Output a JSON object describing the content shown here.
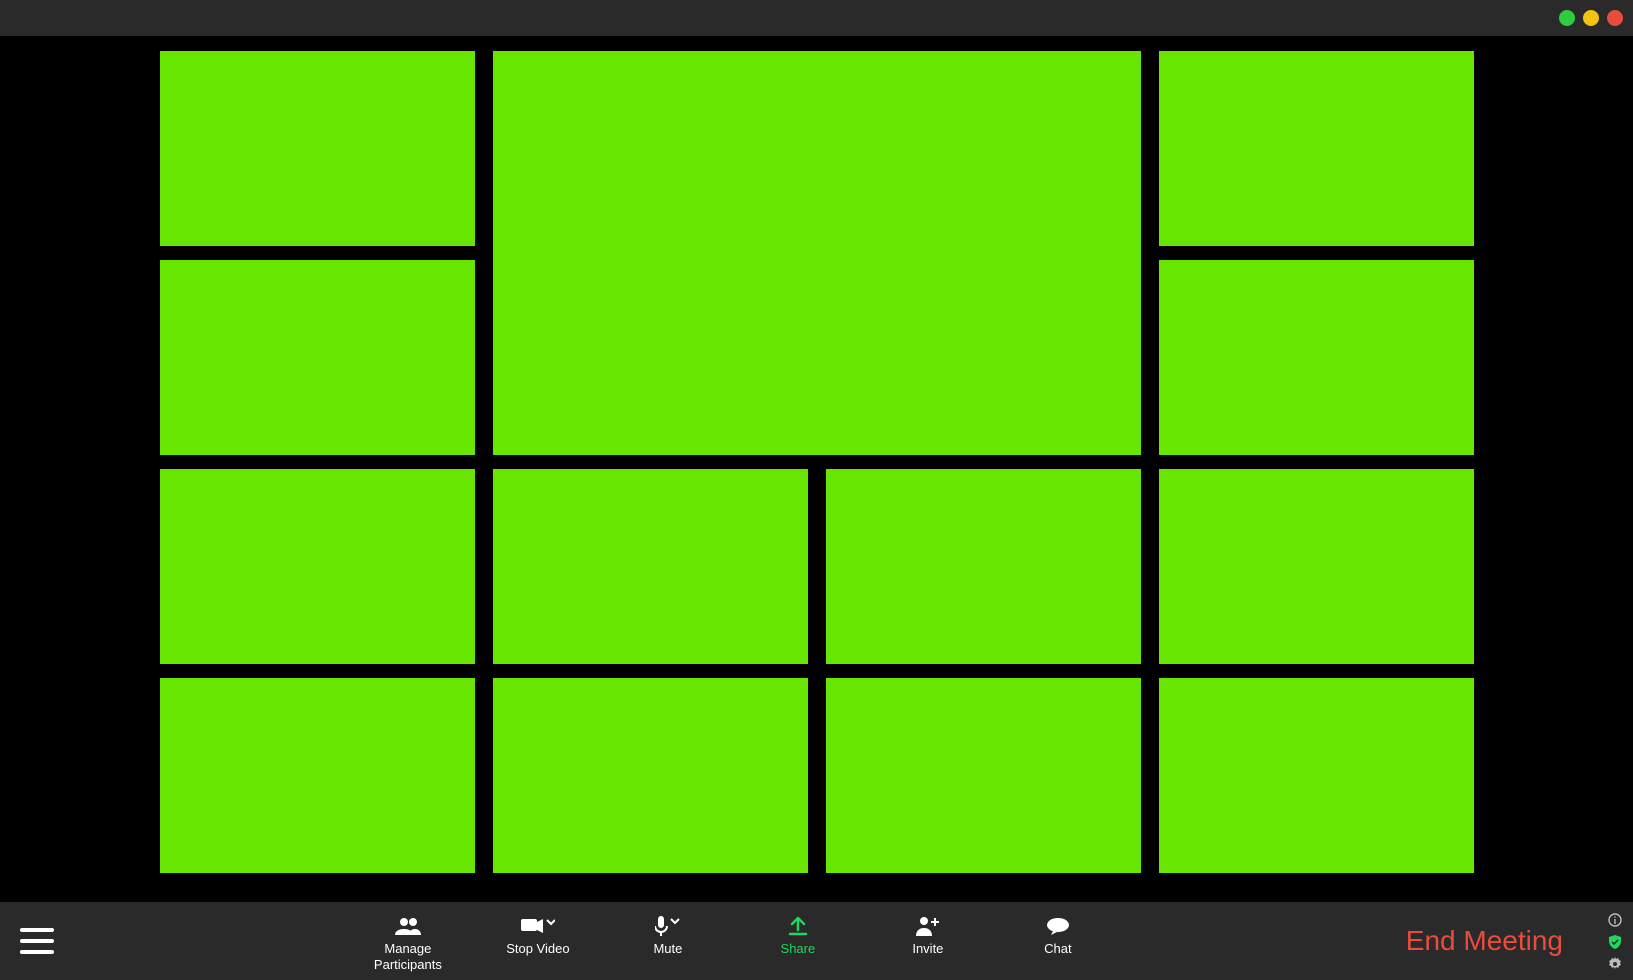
{
  "colors": {
    "tile_fill": "#66e600",
    "titlebar_bg": "#2a2a2a",
    "toolbar_bg": "#2a2a2a",
    "share_accent": "#1fd65f",
    "end_meeting": "#e74c3c",
    "traffic_green": "#2ecc40",
    "traffic_yellow": "#f1c40f",
    "traffic_red": "#e74c3c"
  },
  "titlebar": {
    "traffic_lights": [
      "green",
      "yellow",
      "red"
    ]
  },
  "toolbar": {
    "manage_participants": "Manage\nParticipants",
    "stop_video": "Stop Video",
    "mute": "Mute",
    "share": "Share",
    "invite": "Invite",
    "chat": "Chat",
    "end_meeting": "End Meeting"
  },
  "side_icons": [
    "info",
    "security",
    "settings"
  ]
}
